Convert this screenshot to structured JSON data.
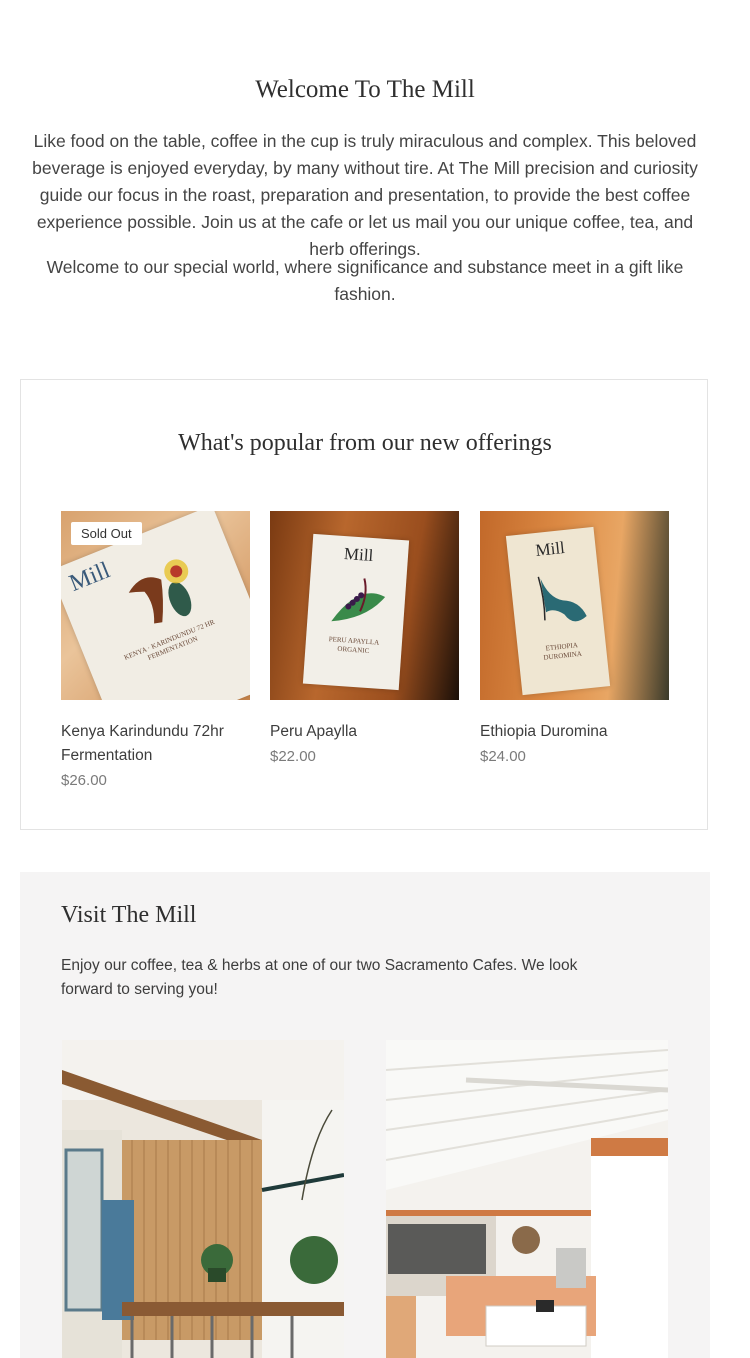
{
  "welcome": {
    "title": "Welcome To The Mill",
    "paragraph1": "Like food on the table, coffee in the cup is truly miraculous and complex. This beloved beverage is enjoyed everyday, by many without tire. At The Mill precision and curiosity guide our focus in the roast, preparation and presentation, to provide the best coffee experience possible. Join us at the cafe or let us mail you our unique coffee, tea, and herb offerings.",
    "paragraph2": "Welcome to our special world, where significance and substance meet in a gift like fashion."
  },
  "popular": {
    "title": "What's popular from our new offerings",
    "products": [
      {
        "name": "Kenya Karindundu 72hr Fermentation",
        "price": "$26.00",
        "badge": "Sold Out",
        "bag_brand": "Mill",
        "bag_text": "KENYA · KARINDUNDU 72 HR FERMENTATION"
      },
      {
        "name": "Peru Apaylla",
        "price": "$22.00",
        "badge": "",
        "bag_brand": "Mill",
        "bag_text": "PERU APAYLLA ORGANIC"
      },
      {
        "name": "Ethiopia Duromina",
        "price": "$24.00",
        "badge": "",
        "bag_brand": "Mill",
        "bag_text": "ETHIOPIA DUROMINA"
      }
    ]
  },
  "visit": {
    "title": "Visit The Mill",
    "description": "Enjoy our coffee, tea & herbs at one of our two Sacramento Cafes. We look forward to serving you!"
  },
  "colors": {
    "section_bg": "#f5f4f4",
    "border": "#e3e3e3",
    "bag_orange": "#b8672d"
  }
}
